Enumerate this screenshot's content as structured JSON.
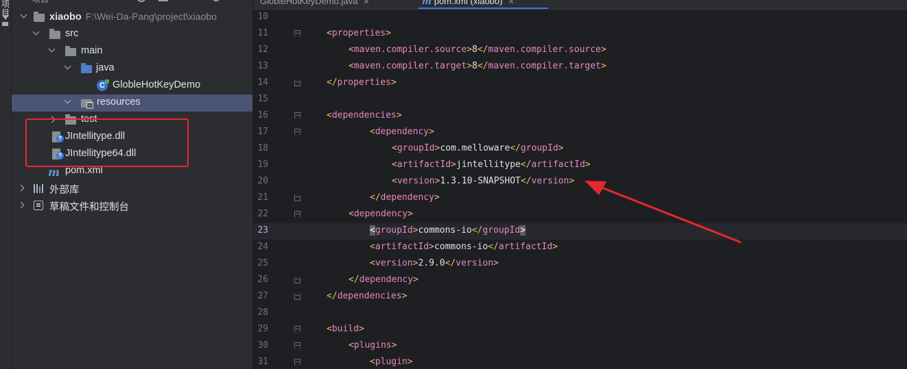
{
  "toolstrip": {
    "label": "项目"
  },
  "project_panel": {
    "header_title": "项目",
    "tree": [
      {
        "label": "xiaobo",
        "path": "F:\\Wei-Da-Pang\\project\\xiaobo"
      },
      {
        "label": "src"
      },
      {
        "label": "main"
      },
      {
        "label": "java"
      },
      {
        "label": "GlobleHotKeyDemo"
      },
      {
        "label": "resources"
      },
      {
        "label": "test"
      },
      {
        "label": "JIntellitype.dll"
      },
      {
        "label": "JIntellitype64.dll"
      },
      {
        "label": "pom.xml"
      },
      {
        "label": "外部库"
      },
      {
        "label": "草稿文件和控制台"
      }
    ]
  },
  "tabs": [
    {
      "label": "GlobleHotKeyDemo.java"
    },
    {
      "label": "pom.xml (xiaobo)"
    }
  ],
  "editor": {
    "lines": [
      {
        "num": "10",
        "parts": []
      },
      {
        "num": "11",
        "parts": [
          [
            "tag",
            "<"
          ],
          [
            "tg",
            "properties"
          ],
          [
            "tag",
            ">"
          ]
        ]
      },
      {
        "num": "12",
        "parts": [
          [
            "tag",
            "<"
          ],
          [
            "tg",
            "maven.compiler.source"
          ],
          [
            "tag",
            ">"
          ],
          [
            "txt",
            "8"
          ],
          [
            "tag",
            "</"
          ],
          [
            "tg",
            "maven.compiler.source"
          ],
          [
            "tag",
            ">"
          ]
        ]
      },
      {
        "num": "13",
        "parts": [
          [
            "tag",
            "<"
          ],
          [
            "tg",
            "maven.compiler.target"
          ],
          [
            "tag",
            ">"
          ],
          [
            "txt",
            "8"
          ],
          [
            "tag",
            "</"
          ],
          [
            "tg",
            "maven.compiler.target"
          ],
          [
            "tag",
            ">"
          ]
        ]
      },
      {
        "num": "14",
        "parts": [
          [
            "tag",
            "</"
          ],
          [
            "tg",
            "properties"
          ],
          [
            "tag",
            ">"
          ]
        ]
      },
      {
        "num": "15",
        "parts": []
      },
      {
        "num": "16",
        "parts": [
          [
            "tag",
            "<"
          ],
          [
            "tg",
            "dependencies"
          ],
          [
            "tag",
            ">"
          ]
        ]
      },
      {
        "num": "17",
        "parts": [
          [
            "tag",
            "<"
          ],
          [
            "tg",
            "dependency"
          ],
          [
            "tag",
            ">"
          ]
        ]
      },
      {
        "num": "18",
        "parts": [
          [
            "tag",
            "<"
          ],
          [
            "tg",
            "groupId"
          ],
          [
            "tag",
            ">"
          ],
          [
            "txt",
            "com.melloware"
          ],
          [
            "tag",
            "</"
          ],
          [
            "tg",
            "groupId"
          ],
          [
            "tag",
            ">"
          ]
        ]
      },
      {
        "num": "19",
        "parts": [
          [
            "tag",
            "<"
          ],
          [
            "tg",
            "artifactId"
          ],
          [
            "tag",
            ">"
          ],
          [
            "txt",
            "jintellitype"
          ],
          [
            "tag",
            "</"
          ],
          [
            "tg",
            "artifactId"
          ],
          [
            "tag",
            ">"
          ]
        ]
      },
      {
        "num": "20",
        "parts": [
          [
            "tag",
            "<"
          ],
          [
            "tg",
            "version"
          ],
          [
            "tag",
            ">"
          ],
          [
            "txt",
            "1.3.10-SNAPSHOT"
          ],
          [
            "tag",
            "</"
          ],
          [
            "tg",
            "version"
          ],
          [
            "tag",
            ">"
          ]
        ]
      },
      {
        "num": "21",
        "parts": [
          [
            "tag",
            "</"
          ],
          [
            "tg",
            "dependency"
          ],
          [
            "tag",
            ">"
          ]
        ]
      },
      {
        "num": "22",
        "parts": [
          [
            "tag",
            "<"
          ],
          [
            "tg",
            "dependency"
          ],
          [
            "tag",
            ">"
          ]
        ]
      },
      {
        "num": "23",
        "parts": [
          [
            "hl",
            "<"
          ],
          [
            "tg",
            "groupId"
          ],
          [
            "tag",
            ">"
          ],
          [
            "txt",
            "commons-io"
          ],
          [
            "tag",
            "</"
          ],
          [
            "tg",
            "groupId"
          ],
          [
            "hl",
            ">"
          ]
        ]
      },
      {
        "num": "24",
        "parts": [
          [
            "tag",
            "<"
          ],
          [
            "tg",
            "artifactId"
          ],
          [
            "tag",
            ">"
          ],
          [
            "txt",
            "commons-io"
          ],
          [
            "tag",
            "</"
          ],
          [
            "tg",
            "artifactId"
          ],
          [
            "tag",
            ">"
          ]
        ]
      },
      {
        "num": "25",
        "parts": [
          [
            "tag",
            "<"
          ],
          [
            "tg",
            "version"
          ],
          [
            "tag",
            ">"
          ],
          [
            "txt",
            "2.9.0"
          ],
          [
            "tag",
            "</"
          ],
          [
            "tg",
            "version"
          ],
          [
            "tag",
            ">"
          ]
        ]
      },
      {
        "num": "26",
        "parts": [
          [
            "tag",
            "</"
          ],
          [
            "tg",
            "dependency"
          ],
          [
            "tag",
            ">"
          ]
        ]
      },
      {
        "num": "27",
        "parts": [
          [
            "tag",
            "</"
          ],
          [
            "tg",
            "dependencies"
          ],
          [
            "tag",
            ">"
          ]
        ]
      },
      {
        "num": "28",
        "parts": []
      },
      {
        "num": "29",
        "parts": [
          [
            "tag",
            "<"
          ],
          [
            "tg",
            "build"
          ],
          [
            "tag",
            ">"
          ]
        ]
      },
      {
        "num": "30",
        "parts": [
          [
            "tag",
            "<"
          ],
          [
            "tg",
            "plugins"
          ],
          [
            "tag",
            ">"
          ]
        ]
      },
      {
        "num": "31",
        "parts": [
          [
            "tag",
            "<"
          ],
          [
            "tg",
            "plugin"
          ],
          [
            "tag",
            ">"
          ]
        ]
      }
    ]
  }
}
